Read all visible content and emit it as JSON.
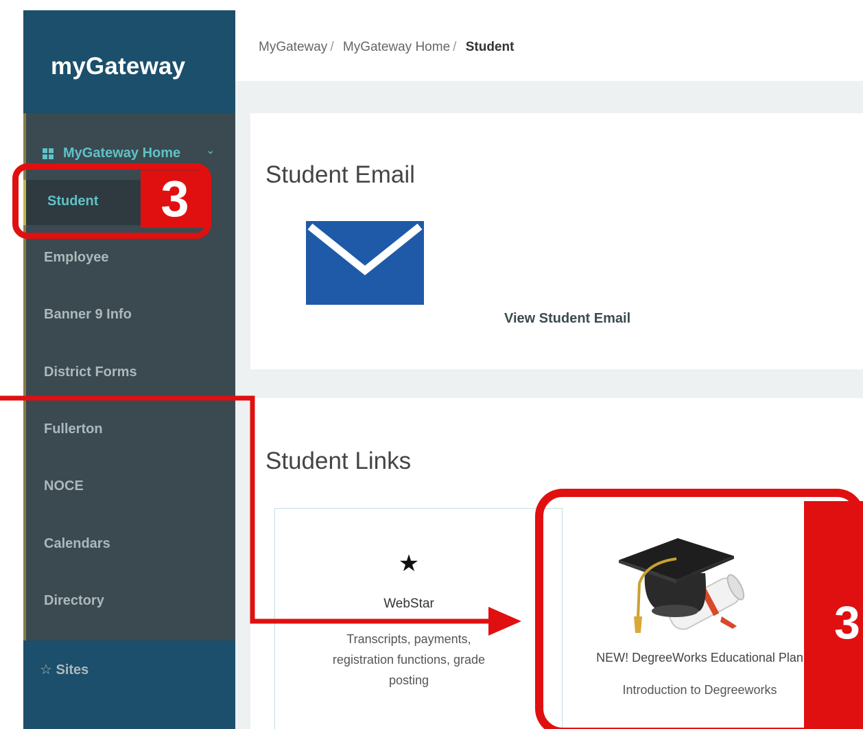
{
  "sidebar": {
    "brand": "myGateway",
    "section_label": "MyGateway Home",
    "items": [
      {
        "label": "Student",
        "active": true
      },
      {
        "label": "Employee"
      },
      {
        "label": "Banner 9 Info"
      },
      {
        "label": "District Forms"
      },
      {
        "label": "Fullerton"
      },
      {
        "label": "NOCE"
      },
      {
        "label": "Calendars"
      },
      {
        "label": "Directory"
      }
    ],
    "sites_label": "Sites"
  },
  "breadcrumb": [
    "MyGateway",
    "MyGateway Home",
    "Student"
  ],
  "email_card": {
    "title": "Student Email",
    "link_label": "View Student Email"
  },
  "links_section": {
    "title": "Student Links",
    "webstar": {
      "title": "WebStar",
      "description": "Transcripts, payments, registration functions, grade posting"
    },
    "degreeworks": {
      "title": "NEW! DegreeWorks Educational Plan",
      "subtitle": "Introduction to Degreeworks"
    }
  },
  "annotations": {
    "step_sidebar": "3",
    "step_tile": "3",
    "color": "#e01010"
  },
  "colors": {
    "brand_bg": "#1b4f6b",
    "sidebar_bg": "#3a4a50",
    "accent_teal": "#5ec2c8",
    "email_blue": "#1f5aa8"
  }
}
